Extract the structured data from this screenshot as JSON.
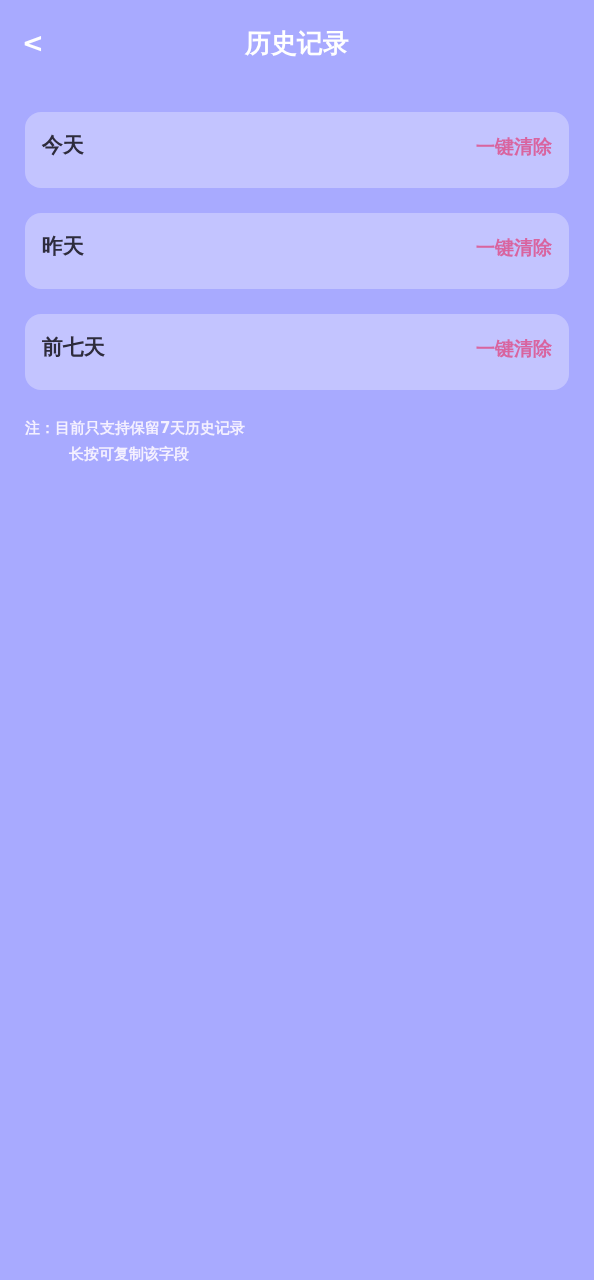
{
  "header": {
    "back": "<",
    "title": "历史记录"
  },
  "sections": [
    {
      "label": "今天",
      "action": "一键清除"
    },
    {
      "label": "昨天",
      "action": "一键清除"
    },
    {
      "label": "前七天",
      "action": "一键清除"
    }
  ],
  "notes": [
    "注：目前只支持保留7天历史记录",
    "长按可复制该字段"
  ]
}
